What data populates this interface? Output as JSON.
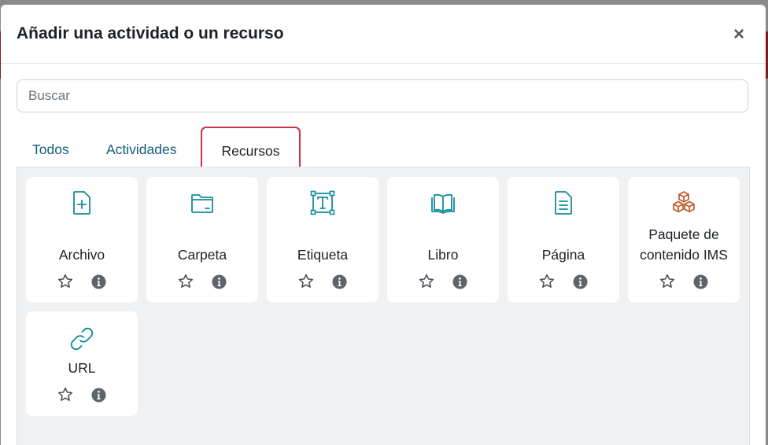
{
  "modal": {
    "title": "Añadir una actividad o un recurso",
    "close_symbol": "×"
  },
  "search": {
    "placeholder": "Buscar",
    "value": ""
  },
  "tabs": [
    {
      "label": "Todos"
    },
    {
      "label": "Actividades"
    },
    {
      "label": "Recursos",
      "selected": true
    }
  ],
  "items": [
    {
      "label": "Archivo",
      "icon": "file-plus-icon"
    },
    {
      "label": "Carpeta",
      "icon": "folder-icon"
    },
    {
      "label": "Etiqueta",
      "icon": "text-box-icon"
    },
    {
      "label": "Libro",
      "icon": "book-icon"
    },
    {
      "label": "Página",
      "icon": "page-icon"
    },
    {
      "label": "Paquete de contenido IMS",
      "icon": "cubes-icon"
    },
    {
      "label": "URL",
      "icon": "link-icon"
    }
  ],
  "colors": {
    "icon_teal": "#138d9c",
    "icon_orange": "#c0582b",
    "tab_link": "#115e7d",
    "highlight": "#c8334a"
  }
}
